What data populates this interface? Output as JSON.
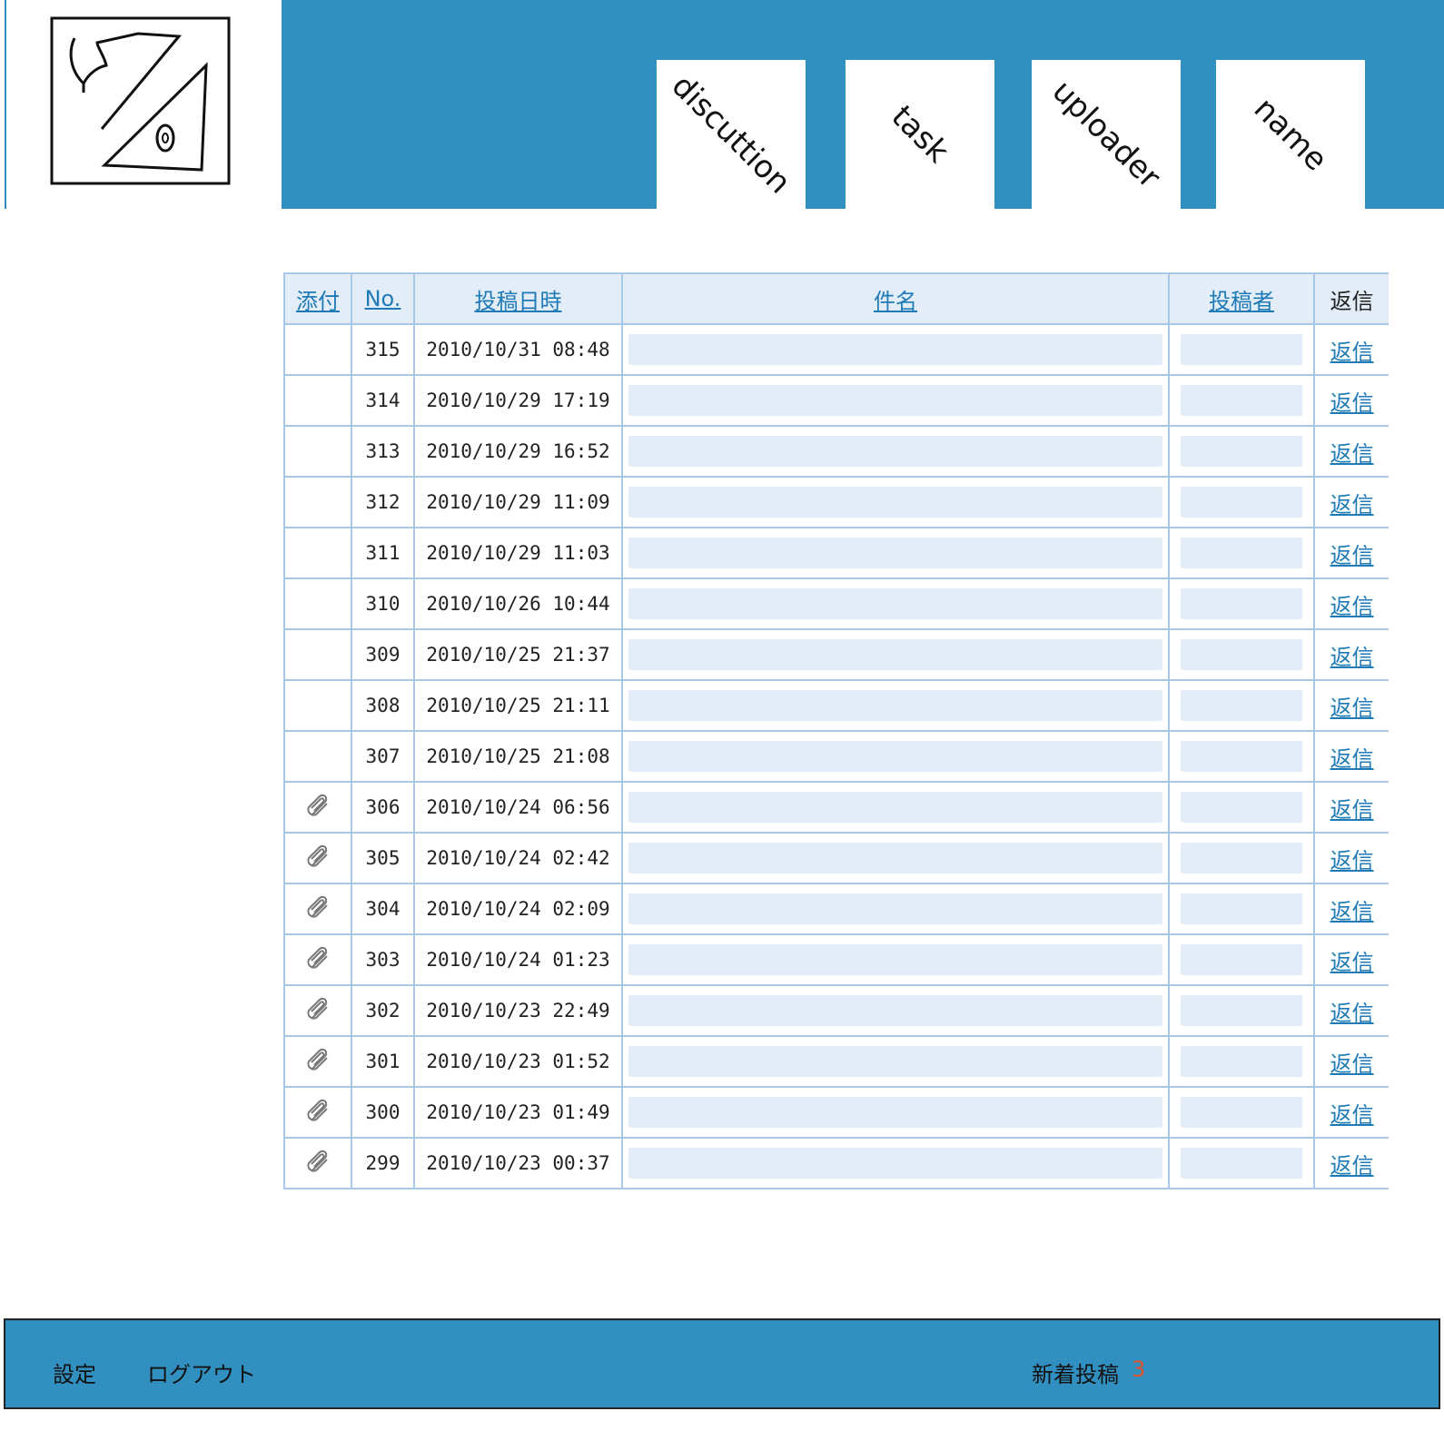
{
  "header": {
    "nav": [
      "discuttion",
      "task",
      "uploader",
      "name"
    ]
  },
  "table": {
    "headers": {
      "attach": "添付",
      "no": "No.",
      "date": "投稿日時",
      "subject": "件名",
      "author": "投稿者",
      "reply": "返信"
    },
    "rows": [
      {
        "attach": false,
        "no": "315",
        "date": "2010/10/31 08:48",
        "reply": "返信"
      },
      {
        "attach": false,
        "no": "314",
        "date": "2010/10/29 17:19",
        "reply": "返信"
      },
      {
        "attach": false,
        "no": "313",
        "date": "2010/10/29 16:52",
        "reply": "返信"
      },
      {
        "attach": false,
        "no": "312",
        "date": "2010/10/29 11:09",
        "reply": "返信"
      },
      {
        "attach": false,
        "no": "311",
        "date": "2010/10/29 11:03",
        "reply": "返信"
      },
      {
        "attach": false,
        "no": "310",
        "date": "2010/10/26 10:44",
        "reply": "返信"
      },
      {
        "attach": false,
        "no": "309",
        "date": "2010/10/25 21:37",
        "reply": "返信"
      },
      {
        "attach": false,
        "no": "308",
        "date": "2010/10/25 21:11",
        "reply": "返信"
      },
      {
        "attach": false,
        "no": "307",
        "date": "2010/10/25 21:08",
        "reply": "返信"
      },
      {
        "attach": true,
        "no": "306",
        "date": "2010/10/24 06:56",
        "reply": "返信"
      },
      {
        "attach": true,
        "no": "305",
        "date": "2010/10/24 02:42",
        "reply": "返信"
      },
      {
        "attach": true,
        "no": "304",
        "date": "2010/10/24 02:09",
        "reply": "返信"
      },
      {
        "attach": true,
        "no": "303",
        "date": "2010/10/24 01:23",
        "reply": "返信"
      },
      {
        "attach": true,
        "no": "302",
        "date": "2010/10/23 22:49",
        "reply": "返信"
      },
      {
        "attach": true,
        "no": "301",
        "date": "2010/10/23 01:52",
        "reply": "返信"
      },
      {
        "attach": true,
        "no": "300",
        "date": "2010/10/23 01:49",
        "reply": "返信"
      },
      {
        "attach": true,
        "no": "299",
        "date": "2010/10/23 00:37",
        "reply": "返信"
      }
    ]
  },
  "footer": {
    "settings": "設定",
    "logout": "ログアウト",
    "new_posts_label": "新着投稿",
    "new_posts_count": "3"
  },
  "colors": {
    "brand": "#3190c0",
    "row_placeholder": "#e3edf8",
    "link": "#1f7ab8",
    "count": "#e0502a"
  },
  "icons": {
    "logo": "hand-drawn-logo",
    "attachment": "paperclip-icon"
  }
}
